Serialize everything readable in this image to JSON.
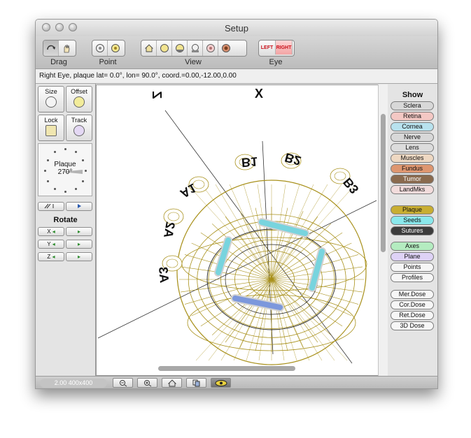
{
  "window": {
    "title": "Setup"
  },
  "toolbar": {
    "groups": [
      {
        "label": "Drag"
      },
      {
        "label": "Point"
      },
      {
        "label": "View"
      },
      {
        "label": "Eye"
      }
    ],
    "eye_left": "LEFT",
    "eye_right": "RIGHT"
  },
  "status": {
    "text": "Right Eye, plaque lat=  0.0°, lon= 90.0°, coord.=0.00,-12.00,0.00"
  },
  "left_panel": {
    "size_label": "Size",
    "offset_label": "Offset",
    "lock_label": "Lock",
    "track_label": "Track",
    "plaque_label": "Plaque",
    "plaque_angle": "270°",
    "rotate_label": "Rotate",
    "axes": [
      "X",
      "Y",
      "Z"
    ]
  },
  "canvas": {
    "axis_labels": [
      "Z",
      "X"
    ],
    "marker_labels": [
      "A1",
      "A2",
      "A3",
      "B1",
      "B2",
      "B3"
    ]
  },
  "show_panel": {
    "title": "Show",
    "buttons": [
      {
        "label": "Sclera",
        "color": "#d8d8d8",
        "text_color": "#111111"
      },
      {
        "label": "Retina",
        "color": "#f4c8c4",
        "text_color": "#111111"
      },
      {
        "label": "Cornea",
        "color": "#b8e2ee",
        "text_color": "#111111"
      },
      {
        "label": "Nerve",
        "color": "#d8d8d8",
        "text_color": "#111111"
      },
      {
        "label": "Lens",
        "color": "#dcdcdc",
        "text_color": "#111111"
      },
      {
        "label": "Muscles",
        "color": "#eed8c2",
        "text_color": "#111111"
      },
      {
        "label": "Fundus",
        "color": "#de9670",
        "text_color": "#111111"
      },
      {
        "label": "Tumor",
        "color": "#8a6a4e",
        "text_color": "#ffffff"
      },
      {
        "label": "LandMks",
        "color": "#f2dcdc",
        "text_color": "#111111"
      },
      {
        "label": "Plaque",
        "color": "#c8ae32",
        "text_color": "#111111"
      },
      {
        "label": "Seeds",
        "color": "#8ae8ec",
        "text_color": "#111111"
      },
      {
        "label": "Sutures",
        "color": "#3c3c3c",
        "text_color": "#ffffff"
      },
      {
        "label": "Axes",
        "color": "#b4ecc0",
        "text_color": "#111111"
      },
      {
        "label": "Plane",
        "color": "#ded2f6",
        "text_color": "#111111"
      },
      {
        "label": "Points",
        "color": "#f6f6f6",
        "text_color": "#111111"
      },
      {
        "label": "Profiles",
        "color": "#f6f6f6",
        "text_color": "#111111"
      },
      {
        "label": "Mer.Dose",
        "color": "#f6f6f6",
        "text_color": "#111111"
      },
      {
        "label": "Cor.Dose",
        "color": "#f6f6f6",
        "text_color": "#111111"
      },
      {
        "label": "Ret.Dose",
        "color": "#f6f6f6",
        "text_color": "#111111"
      },
      {
        "label": "3D Dose",
        "color": "#f6f6f6",
        "text_color": "#111111"
      }
    ]
  },
  "bottom": {
    "zoom_info": "2.00 400x400"
  },
  "colors": {
    "wire": "#a8901a",
    "seed": "#78d4de",
    "seed_blue": "#7c98dc",
    "axis_line": "#333333"
  }
}
